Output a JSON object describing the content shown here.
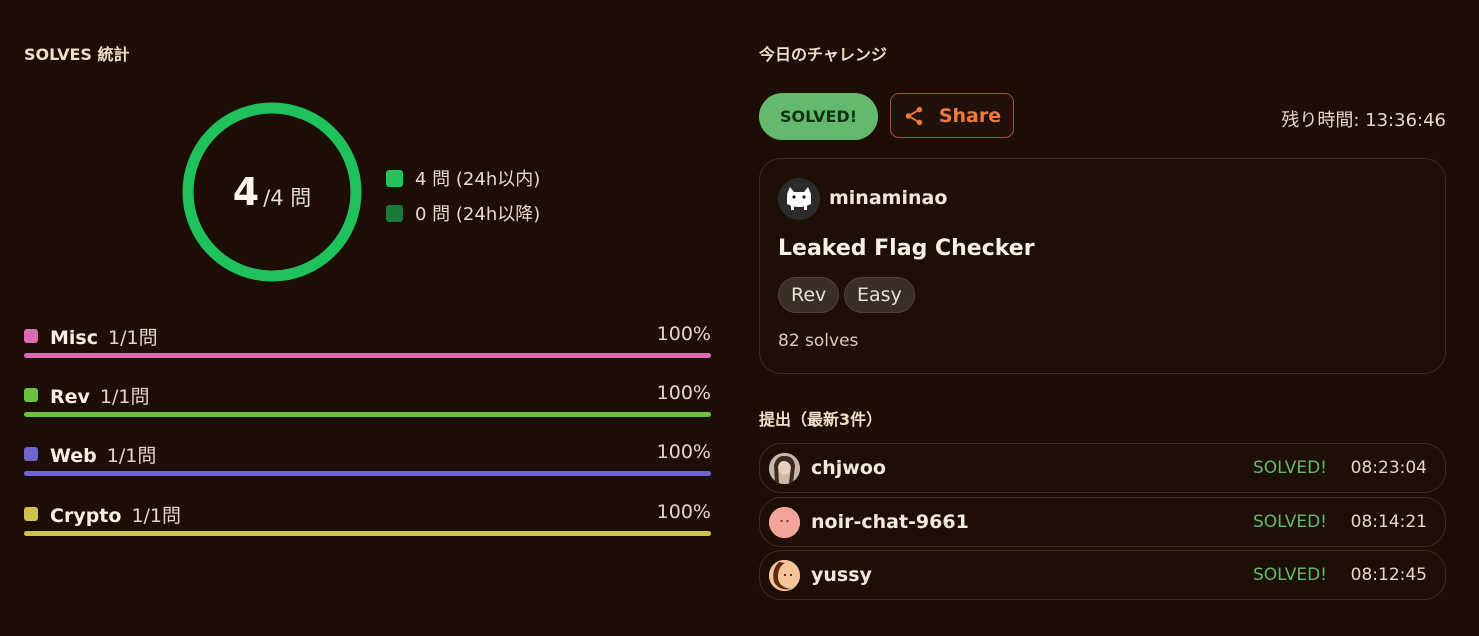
{
  "stats": {
    "title": "SOLVES 統計",
    "solved": "4",
    "total_label": "/4 問",
    "ring_fraction": 1.0,
    "ring_color": "#1fc25a",
    "legend": [
      {
        "label": "4 問 (24h以内)",
        "color": "#22c45b"
      },
      {
        "label": "0 問 (24h以降)",
        "color": "#1a7a3a"
      }
    ],
    "categories": [
      {
        "name": "Misc",
        "count": "1/1問",
        "pct": "100%",
        "fraction": 1.0,
        "color": "#d96cb4"
      },
      {
        "name": "Rev",
        "count": "1/1問",
        "pct": "100%",
        "fraction": 1.0,
        "color": "#6cc23e"
      },
      {
        "name": "Web",
        "count": "1/1問",
        "pct": "100%",
        "fraction": 1.0,
        "color": "#6f64d0"
      },
      {
        "name": "Crypto",
        "count": "1/1問",
        "pct": "100%",
        "fraction": 1.0,
        "color": "#cfc14c"
      }
    ]
  },
  "challenge": {
    "title": "今日のチャレンジ",
    "status": "SOLVED!",
    "share_label": "Share",
    "timer": "残り時間: 13:36:46",
    "author": "minaminao",
    "name": "Leaked Flag Checker",
    "tags": [
      "Rev",
      "Easy"
    ],
    "solves": "82 solves"
  },
  "submissions": {
    "title": "提出（最新3件）",
    "rows": [
      {
        "user": "chjwoo",
        "status": "SOLVED!",
        "time": "08:23:04",
        "avatar_color": "#c9b8a6"
      },
      {
        "user": "noir-chat-9661",
        "status": "SOLVED!",
        "time": "08:14:21",
        "avatar_color": "#f4a49a"
      },
      {
        "user": "yussy",
        "status": "SOLVED!",
        "time": "08:12:45",
        "avatar_color": "#f6c69a"
      }
    ]
  }
}
